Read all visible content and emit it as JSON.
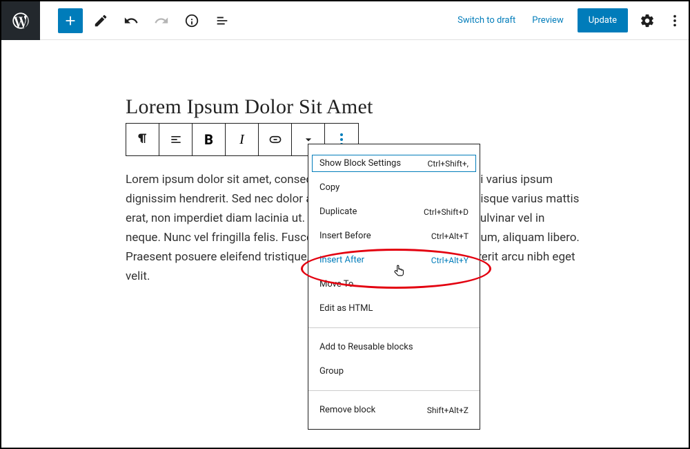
{
  "topbar": {
    "switch_to_draft": "Switch to draft",
    "preview": "Preview",
    "update": "Update"
  },
  "post": {
    "title": "Lorem Ipsum Dolor Sit Amet",
    "body": "Lorem ipsum dolor sit amet, consectetur adipiscing elit. Sed quis nisi varius ipsum dignissim hendrerit. Sed nec dolor auctor metus tincidunt iaculis. Quisque varius mattis erat, non imperdiet diam lacinia ut. Donec pharetra vel justo lacinia pulvinar vel in neque. Nunc vel fringilla felis. Fusce elit sem, suscipit lorem elementum, aliquam libero. Praesent posuere eleifend tristique, erat est pretium magna, ut hendrerit arcu nibh eget velit."
  },
  "block_toolbar": {
    "bold": "B",
    "italic": "I"
  },
  "menu": {
    "sections": [
      [
        {
          "label": "Show Block Settings",
          "shortcut": "Ctrl+Shift+,"
        },
        {
          "label": "Copy",
          "shortcut": ""
        },
        {
          "label": "Duplicate",
          "shortcut": "Ctrl+Shift+D"
        },
        {
          "label": "Insert Before",
          "shortcut": "Ctrl+Alt+T"
        },
        {
          "label": "Insert After",
          "shortcut": "Ctrl+Alt+Y"
        },
        {
          "label": "Move To",
          "shortcut": ""
        },
        {
          "label": "Edit as HTML",
          "shortcut": ""
        }
      ],
      [
        {
          "label": "Add to Reusable blocks",
          "shortcut": ""
        },
        {
          "label": "Group",
          "shortcut": ""
        }
      ],
      [
        {
          "label": "Remove block",
          "shortcut": "Shift+Alt+Z"
        }
      ]
    ]
  }
}
